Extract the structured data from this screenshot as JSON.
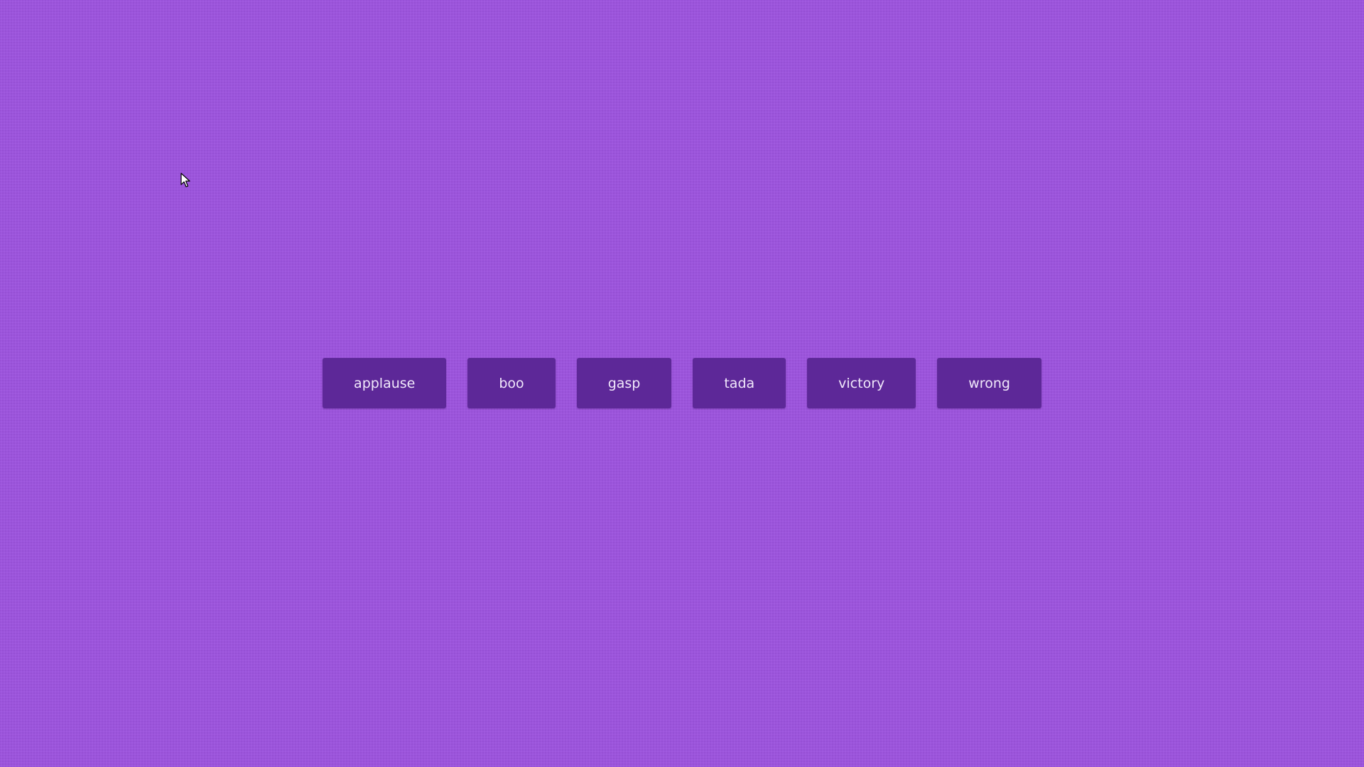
{
  "colors": {
    "background": "#9c54dc",
    "button": "#5d2898",
    "button_text": "#f1e8fb"
  },
  "buttons": [
    {
      "label": "applause"
    },
    {
      "label": "boo"
    },
    {
      "label": "gasp"
    },
    {
      "label": "tada"
    },
    {
      "label": "victory"
    },
    {
      "label": "wrong"
    }
  ],
  "cursor": {
    "icon": "mouse-pointer-icon"
  }
}
